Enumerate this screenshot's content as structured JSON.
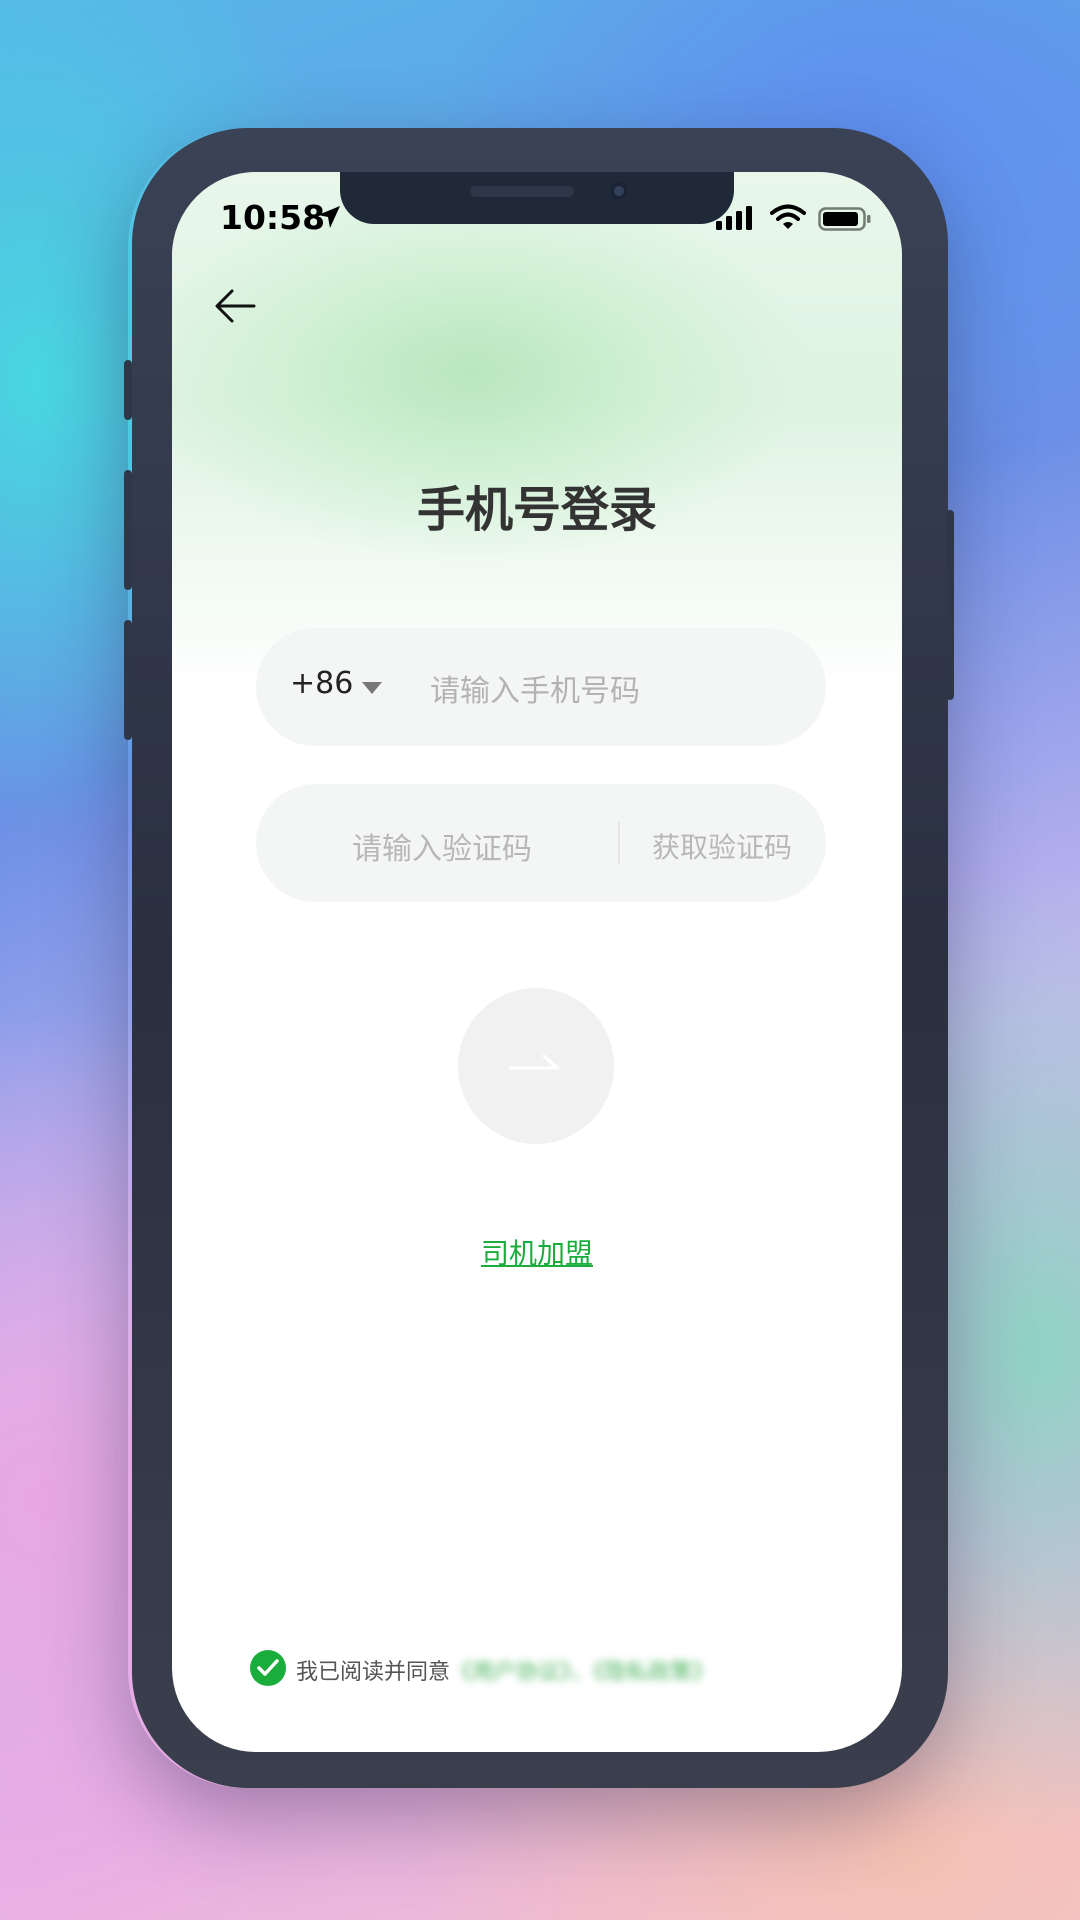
{
  "status_bar": {
    "time": "10:58"
  },
  "header": {
    "back_icon": "arrow-left-icon"
  },
  "title": "手机号登录",
  "phone_field": {
    "country_code": "+86",
    "placeholder": "请输入手机号码"
  },
  "code_field": {
    "placeholder": "请输入验证码",
    "get_code_label": "获取验证码"
  },
  "submit": {
    "icon": "double-arrow-right-icon"
  },
  "driver_join_link": "司机加盟",
  "agreement": {
    "checked": true,
    "prefix": "我已阅读并同意",
    "links_blurred": "《用户协议》、《隐私政策》"
  },
  "colors": {
    "accent": "#1aac3c",
    "field_bg": "#f4f6f5",
    "title": "#333333"
  }
}
